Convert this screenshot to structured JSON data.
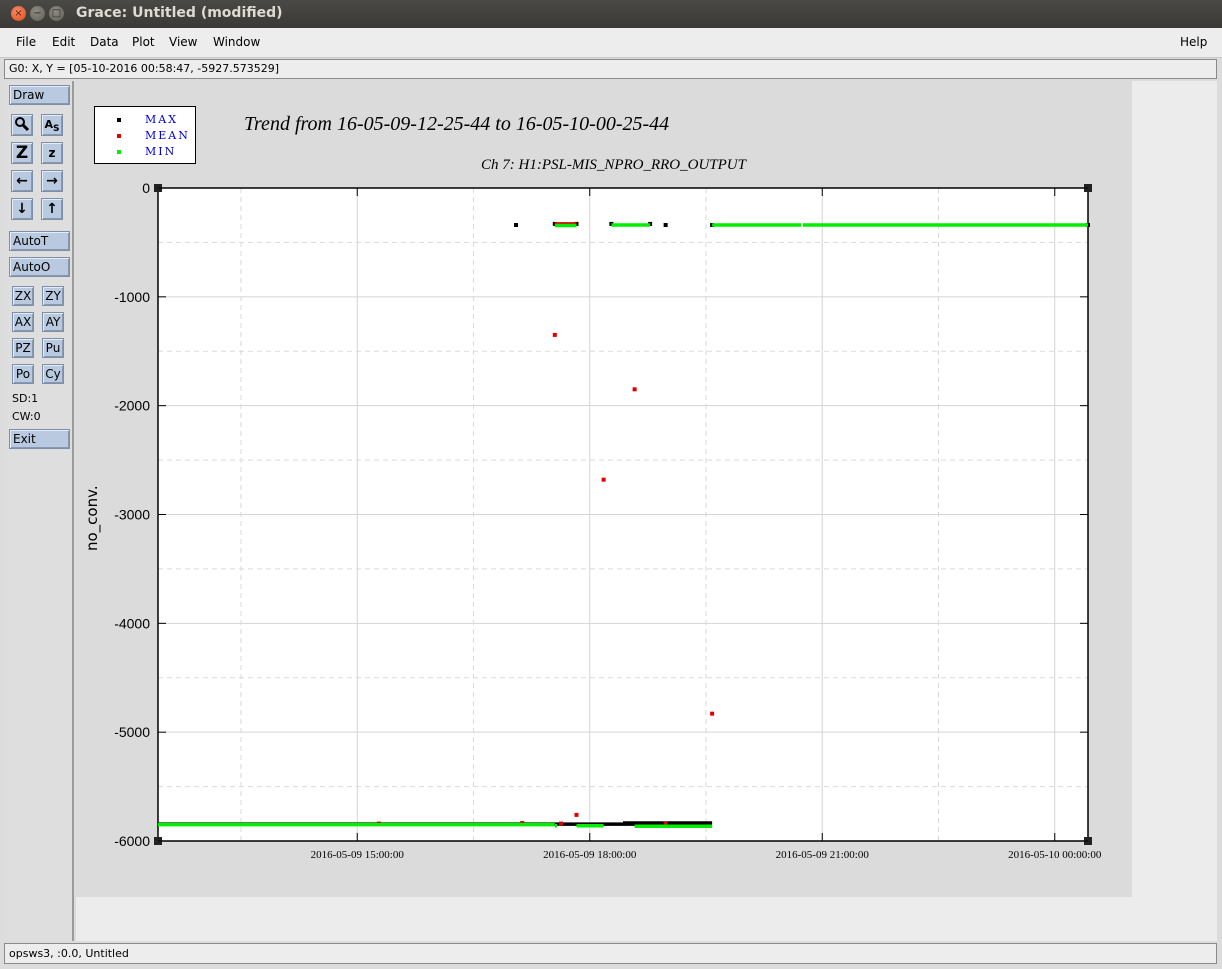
{
  "window": {
    "title": "Grace: Untitled (modified)"
  },
  "menu": {
    "file": "File",
    "edit": "Edit",
    "data": "Data",
    "plot": "Plot",
    "view": "View",
    "window": "Window",
    "help": "Help"
  },
  "locator": "G0: X, Y = [05-10-2016 00:58:47, -5927.573529]",
  "tools": {
    "draw": "Draw",
    "autot": "AutoT",
    "autoo": "AutoO",
    "zx": "ZX",
    "zy": "ZY",
    "ax": "AX",
    "ay": "AY",
    "pz": "PZ",
    "pu": "Pu",
    "po": "Po",
    "cy": "Cy",
    "sd": "SD:1",
    "cw": "CW:0",
    "exit": "Exit"
  },
  "icons": [
    "zoom-icon",
    "text-edit-icon",
    "zoom-in-icon",
    "zoom-out-icon",
    "arrow-left-icon",
    "arrow-right-icon",
    "arrow-down-icon",
    "arrow-up-icon"
  ],
  "plot": {
    "title": "Trend from 16-05-09-12-25-44 to 16-05-10-00-25-44",
    "subtitle": "Ch 7: H1:PSL-MIS_NPRO_RRO_OUTPUT",
    "ylabel": "no_conv.",
    "legend": [
      {
        "label": "MAX",
        "color": "#000000"
      },
      {
        "label": "MEAN",
        "color": "#dd0000"
      },
      {
        "label": "MIN",
        "color": "#00ee00"
      }
    ]
  },
  "chart_data": {
    "type": "scatter",
    "title": "Trend from 16-05-09-12-25-44 to 16-05-10-00-25-44",
    "subtitle": "Ch 7: H1:PSL-MIS_NPRO_RRO_OUTPUT",
    "xlabel": "",
    "ylabel": "no_conv.",
    "x_unit": "hours since 2016-05-09 12:25:44",
    "xlim": [
      0,
      12
    ],
    "ylim": [
      -6000,
      0
    ],
    "x_ticks": [
      {
        "x": 2.571,
        "label": "2016-05-09 15:00:00"
      },
      {
        "x": 5.571,
        "label": "2016-05-09 18:00:00"
      },
      {
        "x": 8.571,
        "label": "2016-05-09 21:00:00"
      },
      {
        "x": 11.571,
        "label": "2016-05-10 00:00:00"
      }
    ],
    "y_ticks": [
      0,
      -1000,
      -2000,
      -3000,
      -4000,
      -5000,
      -6000
    ],
    "grid": true,
    "legend_position": "top-left",
    "series": [
      {
        "name": "MAX",
        "color": "#000000",
        "segments": [
          {
            "x0": 0.0,
            "x1": 6.85,
            "y": -5845
          },
          {
            "x0": 6.0,
            "x1": 7.15,
            "y": -5835
          }
        ],
        "points": [
          [
            4.62,
            -340
          ],
          [
            6.55,
            -340
          ],
          [
            5.12,
            -330
          ],
          [
            5.4,
            -330
          ],
          [
            5.85,
            -330
          ],
          [
            6.35,
            -330
          ],
          [
            7.15,
            -340
          ],
          [
            12.0,
            -340
          ]
        ]
      },
      {
        "name": "MEAN",
        "color": "#dd0000",
        "segments": [
          {
            "x0": 5.12,
            "x1": 5.4,
            "y": -330
          }
        ],
        "points": [
          [
            5.12,
            -1350
          ],
          [
            6.15,
            -1850
          ],
          [
            5.75,
            -2680
          ],
          [
            7.15,
            -4830
          ],
          [
            5.4,
            -5760
          ],
          [
            2.85,
            -5840
          ],
          [
            6.55,
            -5840
          ],
          [
            4.7,
            -5835
          ],
          [
            5.2,
            -5840
          ]
        ]
      },
      {
        "name": "MIN",
        "color": "#00ee00",
        "segments": [
          {
            "x0": 0.0,
            "x1": 5.12,
            "y": -5850
          },
          {
            "x0": 5.12,
            "x1": 5.15,
            "y": -5860
          },
          {
            "x0": 5.4,
            "x1": 5.75,
            "y": -5860
          },
          {
            "x0": 6.15,
            "x1": 7.15,
            "y": -5865
          },
          {
            "x0": 5.12,
            "x1": 5.4,
            "y": -345
          },
          {
            "x0": 5.85,
            "x1": 6.35,
            "y": -340
          },
          {
            "x0": 7.15,
            "x1": 8.3,
            "y": -340
          },
          {
            "x0": 8.32,
            "x1": 12.0,
            "y": -340
          }
        ],
        "points": []
      }
    ]
  },
  "status": "opsws3, :0.0, Untitled"
}
